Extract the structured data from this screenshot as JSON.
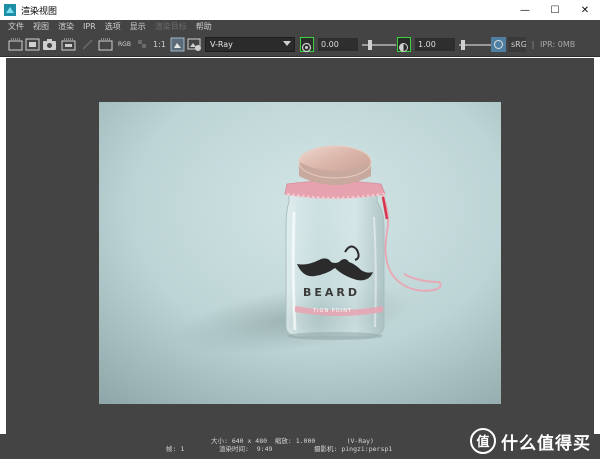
{
  "window": {
    "title": "渲染视图",
    "controls": {
      "minimize": "—",
      "maximize": "☐",
      "close": "✕"
    }
  },
  "menu": {
    "items": [
      {
        "label": "文件",
        "enabled": true
      },
      {
        "label": "视图",
        "enabled": true
      },
      {
        "label": "渲染",
        "enabled": true
      },
      {
        "label": "IPR",
        "enabled": true
      },
      {
        "label": "选项",
        "enabled": true
      },
      {
        "label": "显示",
        "enabled": true
      },
      {
        "label": "渲染目标",
        "enabled": false
      },
      {
        "label": "帮助",
        "enabled": true
      }
    ]
  },
  "toolbar": {
    "rgb_label": "RGB",
    "ratio_label": "1:1",
    "renderer": "V-Ray",
    "exposure_value": "0.00",
    "gamma_value": "1.00",
    "colorspace": "sRG",
    "ipr_memory": "IPR: 0MB"
  },
  "status": {
    "line1": "大小: 640 x 480  缩放: 1.000        (V-Ray)",
    "frame_label": "帧: 1",
    "render_time_label": "渲染时间:  9:49",
    "camera_label": "摄影机: pingzi:persp1"
  },
  "render": {
    "label_text": "BEARD",
    "ribbon_text": "TION POINT"
  },
  "watermark": {
    "text": "什么值得买",
    "icon_glyph": "值"
  },
  "colors": {
    "panel_bg": "#444444",
    "render_bg": "#b9d2d2",
    "lid": "#d9b9ae",
    "ring": "#e8a2b0",
    "highlight_green": "#3bd13b"
  }
}
